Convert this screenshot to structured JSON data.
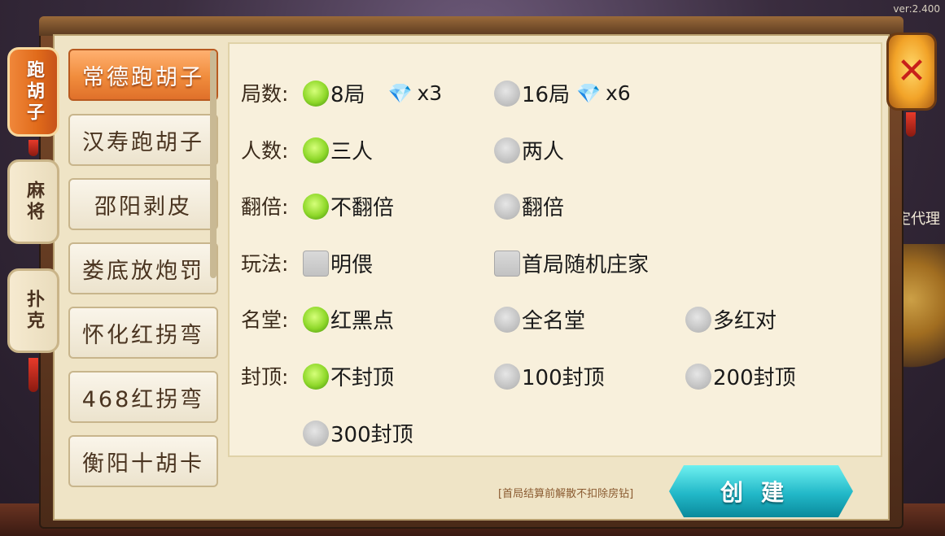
{
  "version": "ver:2.400",
  "side_deco": {
    "agent_text": "定代理"
  },
  "close_button": {
    "icon": "x-icon",
    "glyph": "✕"
  },
  "categories": [
    {
      "label": "跑胡子",
      "active": true
    },
    {
      "label": "麻将",
      "active": false
    },
    {
      "label": "扑克",
      "active": false
    }
  ],
  "games": [
    {
      "label": "常德跑胡子",
      "active": true
    },
    {
      "label": "汉寿跑胡子",
      "active": false
    },
    {
      "label": "邵阳剥皮",
      "active": false
    },
    {
      "label": "娄底放炮罚",
      "active": false
    },
    {
      "label": "怀化红拐弯",
      "active": false
    },
    {
      "label": "468红拐弯",
      "active": false
    },
    {
      "label": "衡阳十胡卡",
      "active": false
    }
  ],
  "options": {
    "rounds": {
      "label": "局数:",
      "choices": [
        {
          "label": "8局",
          "cost": "x3",
          "selected": true
        },
        {
          "label": "16局",
          "cost": "x6",
          "selected": false
        }
      ]
    },
    "players": {
      "label": "人数:",
      "choices": [
        {
          "label": "三人",
          "selected": true
        },
        {
          "label": "两人",
          "selected": false
        }
      ]
    },
    "double": {
      "label": "翻倍:",
      "choices": [
        {
          "label": "不翻倍",
          "selected": true
        },
        {
          "label": "翻倍",
          "selected": false
        }
      ]
    },
    "play": {
      "label": "玩法:",
      "choices": [
        {
          "label": "明偎",
          "checked": false
        },
        {
          "label": "首局随机庄家",
          "checked": false
        }
      ]
    },
    "famous": {
      "label": "名堂:",
      "choices": [
        {
          "label": "红黑点",
          "selected": true
        },
        {
          "label": "全名堂",
          "selected": false
        },
        {
          "label": "多红对",
          "selected": false
        }
      ]
    },
    "cap": {
      "label": "封顶:",
      "choices": [
        {
          "label": "不封顶",
          "selected": true
        },
        {
          "label": "100封顶",
          "selected": false
        },
        {
          "label": "200封顶",
          "selected": false
        },
        {
          "label": "300封顶",
          "selected": false
        }
      ]
    }
  },
  "note": "[首局结算前解散不扣除房钻]",
  "create_label": "创建",
  "colors": {
    "accent": "#f08c3c",
    "create": "#22b8c8",
    "radio_on": "#8fd82a"
  }
}
